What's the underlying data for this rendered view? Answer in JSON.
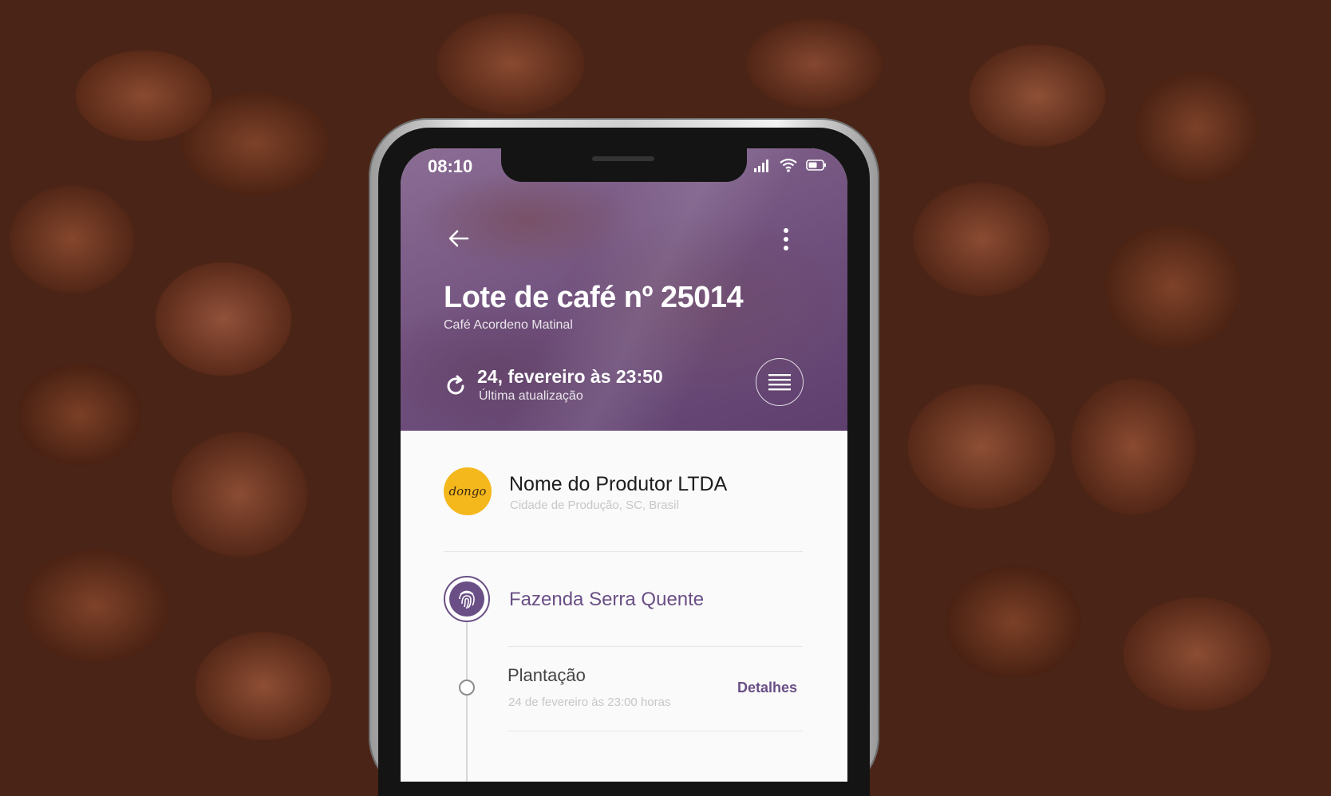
{
  "status_bar": {
    "time": "08:10"
  },
  "lot": {
    "title": "Lote de café nº 25014",
    "subtitle": "Café Acordeno Matinal"
  },
  "update": {
    "date": "24, fevereiro às 23:50",
    "label": "Última atualização"
  },
  "producer": {
    "logo_text": "dongo",
    "name": "Nome do Produtor LTDA",
    "location": "Cidade de Produção, SC, Brasil"
  },
  "farm": {
    "name": "Fazenda Serra Quente"
  },
  "steps": [
    {
      "title": "Plantação",
      "date": "24 de fevereiro às 23:00 horas",
      "link": "Detalhes"
    }
  ],
  "colors": {
    "accent": "#6a4f86",
    "logo_bg": "#f4b71c",
    "hero_overlay": "#6f4f7c"
  },
  "icons": [
    "back-arrow-icon",
    "more-vertical-icon",
    "refresh-icon",
    "menu-lines-icon",
    "fingerprint-icon",
    "signal-icon",
    "wifi-icon",
    "battery-icon"
  ]
}
